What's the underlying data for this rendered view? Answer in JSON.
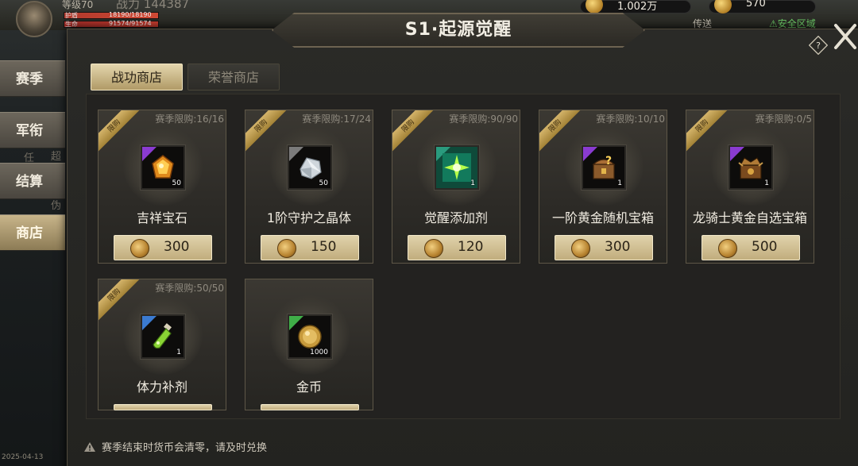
{
  "hud": {
    "level_text": "等级70",
    "power_text": "战力 144387",
    "hp_label": "护盾",
    "hp_value": "18190/18190",
    "life_label": "生命",
    "life_value": "91574/91574",
    "currency1": "1.002万",
    "currency2": "570",
    "transfer": "传送",
    "safe_zone": "⚠安全区域"
  },
  "side_tabs": [
    "赛季",
    "军衔",
    "结算",
    "商店"
  ],
  "side_active": "商店",
  "side_stubs": [
    "任",
    "超",
    "伪"
  ],
  "date": "2025-04-13",
  "title": "S1·起源觉醒",
  "tabs": {
    "active": "战功商店",
    "inactive": "荣誉商店"
  },
  "ribbon_label": "限购",
  "items": [
    {
      "name": "吉祥宝石",
      "limit": "赛季限购:16/16",
      "qty": "50",
      "price": "300",
      "quality_color": "#8a3bd1",
      "icon": "gem-icon"
    },
    {
      "name": "1阶守护之晶体",
      "limit": "赛季限购:17/24",
      "qty": "50",
      "price": "150",
      "quality_color": "#7b7b7b",
      "icon": "crystal-icon"
    },
    {
      "name": "觉醒添加剂",
      "limit": "赛季限购:90/90",
      "qty": "1",
      "price": "120",
      "quality_color": "#2a9b7e",
      "icon": "burst-icon"
    },
    {
      "name": "一阶黄金随机宝箱",
      "limit": "赛季限购:10/10",
      "qty": "1",
      "price": "300",
      "quality_color": "#8a3bd1",
      "icon": "mystery-chest-icon"
    },
    {
      "name": "龙骑士黄金自选宝箱",
      "limit": "赛季限购:0/5",
      "qty": "1",
      "price": "500",
      "quality_color": "#8a3bd1",
      "icon": "dragon-chest-icon"
    },
    {
      "name": "体力补剂",
      "limit": "赛季限购:50/50",
      "qty": "1",
      "price": "",
      "quality_color": "#3b7bd1",
      "icon": "potion-icon"
    },
    {
      "name": "金币",
      "limit": "",
      "qty": "1000",
      "price": "",
      "quality_color": "#3fae48",
      "icon": "gold-coin-icon"
    }
  ],
  "footer": "赛季结束时货币会清零，请及时兑换"
}
